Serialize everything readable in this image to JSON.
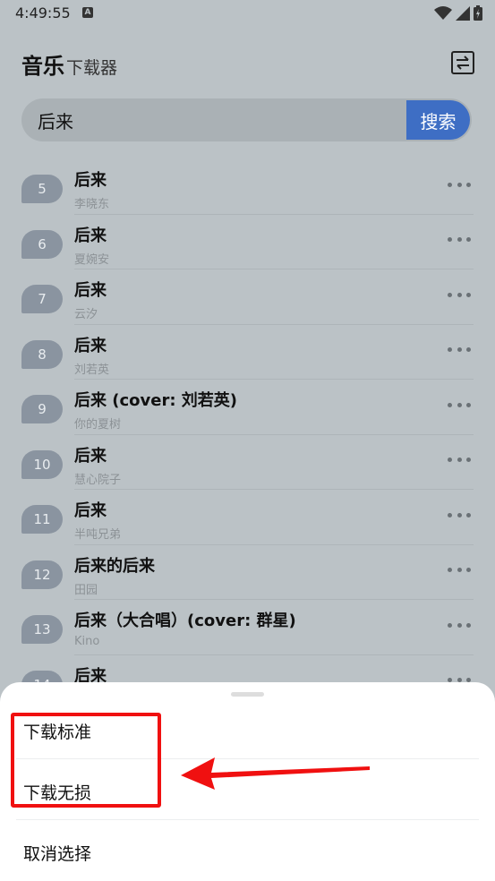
{
  "status_bar": {
    "time": "4:49:55",
    "notification_glyph": "A"
  },
  "header": {
    "title_main": "音乐",
    "title_sub": "下载器",
    "switch_icon": "swap-icon"
  },
  "search": {
    "value": "后来",
    "button_label": "搜索"
  },
  "results": [
    {
      "index": "5",
      "title": "后来",
      "artist": "李晓东"
    },
    {
      "index": "6",
      "title": "后来",
      "artist": "夏婉安"
    },
    {
      "index": "7",
      "title": "后来",
      "artist": "云汐"
    },
    {
      "index": "8",
      "title": "后来",
      "artist": "刘若英"
    },
    {
      "index": "9",
      "title": "后来 (cover: 刘若英)",
      "artist": "你的夏树"
    },
    {
      "index": "10",
      "title": "后来",
      "artist": "慧心院子"
    },
    {
      "index": "11",
      "title": "后来",
      "artist": "半吨兄弟"
    },
    {
      "index": "12",
      "title": "后来的后来",
      "artist": "田园"
    },
    {
      "index": "13",
      "title": "后来（大合唱）(cover: 群星)",
      "artist": "Kino"
    },
    {
      "index": "14",
      "title": "后来",
      "artist": ""
    }
  ],
  "sheet": {
    "download_standard": "下载标准",
    "download_lossless": "下载无损",
    "cancel_selection": "取消选择"
  },
  "colors": {
    "accent": "#3e6ec4",
    "annotation": "#f01010",
    "scrim_background": "#bbc2c6"
  }
}
